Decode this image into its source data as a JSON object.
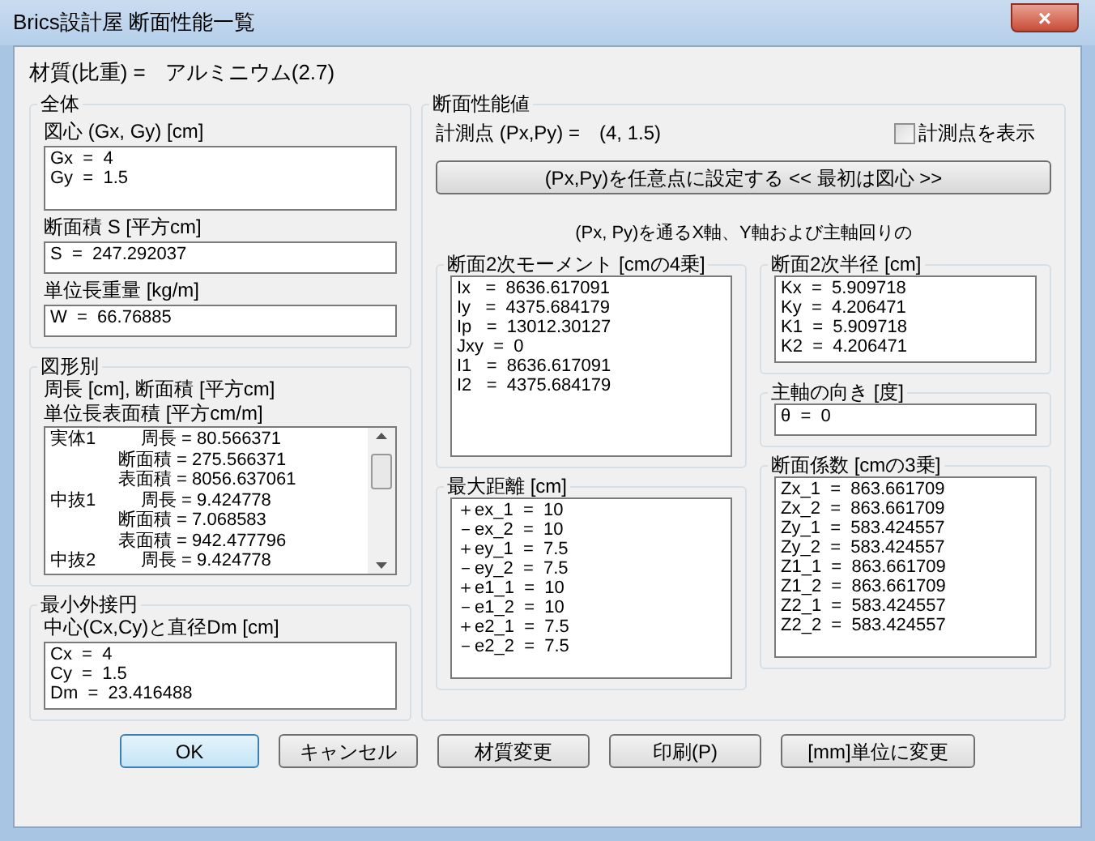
{
  "window": {
    "title": "Brics設計屋 断面性能一覧",
    "close": "×"
  },
  "material": {
    "label": "材質(比重) =",
    "value": "アルミニウム(2.7)"
  },
  "overall": {
    "title": "全体",
    "fields": [
      {
        "label": "図心 (Gx, Gy) [cm]",
        "lines": [
          "Gx  =  4",
          "Gy  =  1.5"
        ]
      },
      {
        "label": "断面積 S [平方cm]",
        "lines": [
          "S  =  247.292037"
        ]
      },
      {
        "label": "単位長重量 [kg/m]",
        "lines": [
          "W  =  66.76885"
        ]
      }
    ]
  },
  "by_shape": {
    "title": "図形別",
    "captions": [
      "周長 [cm], 断面積 [平方cm]",
      "単位長表面積 [平方cm/m]"
    ],
    "items": [
      {
        "label": "実体1",
        "lines": [
          "周長 = 80.566371",
          "断面積 = 275.566371",
          "表面積 = 8056.637061"
        ]
      },
      {
        "label": "中抜1",
        "lines": [
          "周長 = 9.424778",
          "断面積 = 7.068583",
          "表面積 = 942.477796"
        ]
      },
      {
        "label": "中抜2",
        "lines": [
          "周長 = 9.424778"
        ]
      }
    ]
  },
  "min_circle": {
    "title": "最小外接円",
    "label": "中心(Cx,Cy)と直径Dm [cm]",
    "lines": [
      "Cx  =  4",
      "Cy  =  1.5",
      "Dm  =  23.416488"
    ]
  },
  "section": {
    "title": "断面性能値",
    "point_label": "計測点 (Px,Py) =",
    "point_value": "(4, 1.5)",
    "show_point": {
      "label": "計測点を表示",
      "checked": false
    },
    "set_button": "(Px,Py)を任意点に設定する << 最初は図心 >>",
    "note": "(Px, Py)を通るX軸、Y軸および主軸回りの",
    "moment": {
      "title": "断面2次モーメント [cmの4乗]",
      "lines": [
        "Ix   =  8636.617091",
        "Iy   =  4375.684179",
        "Ip   =  13012.30127",
        "Jxy  =  0",
        "I1   =  8636.617091",
        "I2   =  4375.684179"
      ]
    },
    "radius": {
      "title": "断面2次半径 [cm]",
      "lines": [
        "Kx  =  5.909718",
        "Ky  =  4.206471",
        "K1  =  5.909718",
        "K2  =  4.206471"
      ]
    },
    "principal": {
      "title": "主軸の向き [度]",
      "lines": [
        "θ  =  0"
      ]
    },
    "distance": {
      "title": "最大距離 [cm]",
      "lines": [
        "＋ex_1  =  10",
        "－ex_2  =  10",
        "＋ey_1  =  7.5",
        "－ey_2  =  7.5",
        "＋e1_1  =  10",
        "－e1_2  =  10",
        "＋e2_1  =  7.5",
        "－e2_2  =  7.5"
      ]
    },
    "modulus": {
      "title": "断面係数 [cmの3乗]",
      "lines": [
        "Zx_1  =  863.661709",
        "Zx_2  =  863.661709",
        "Zy_1  =  583.424557",
        "Zy_2  =  583.424557",
        "Z1_1  =  863.661709",
        "Z1_2  =  863.661709",
        "Z2_1  =  583.424557",
        "Z2_2  =  583.424557"
      ]
    }
  },
  "buttons": [
    {
      "label": "OK",
      "default": true
    },
    {
      "label": "キャンセル",
      "default": false
    },
    {
      "label": "材質変更",
      "default": false
    },
    {
      "label": "印刷(P)",
      "default": false
    },
    {
      "label": "[mm]単位に変更",
      "default": false
    }
  ]
}
